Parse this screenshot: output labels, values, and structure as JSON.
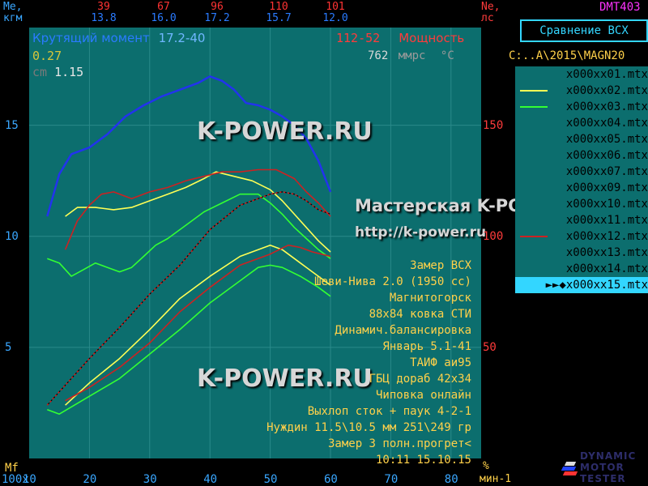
{
  "header": {
    "left_unit_line1": "Ме,",
    "left_unit_line2": "кгм",
    "right_unit_line1": "Ne,",
    "right_unit_line2": "лс",
    "device": "DMT403",
    "columns": [
      {
        "top": "39",
        "bottom": "13.8"
      },
      {
        "top": "67",
        "bottom": "16.0"
      },
      {
        "top": "96",
        "bottom": "17.2"
      },
      {
        "top": "110",
        "bottom": "15.7"
      },
      {
        "top": "101",
        "bottom": "12.0"
      }
    ]
  },
  "compare_button": "Сравнение  ВСХ",
  "path": "C:..A\\2015\\MAGN20",
  "files": [
    {
      "name": "x000xx01.mtx",
      "swatch": ""
    },
    {
      "name": "x000xx02.mtx",
      "swatch": "#ffff55"
    },
    {
      "name": "x000xx03.mtx",
      "swatch": "#33ff33"
    },
    {
      "name": "x000xx04.mtx",
      "swatch": ""
    },
    {
      "name": "x000xx05.mtx",
      "swatch": ""
    },
    {
      "name": "x000xx06.mtx",
      "swatch": ""
    },
    {
      "name": "x000xx07.mtx",
      "swatch": ""
    },
    {
      "name": "x000xx09.mtx",
      "swatch": ""
    },
    {
      "name": "x000xx10.mtx",
      "swatch": ""
    },
    {
      "name": "x000xx11.mtx",
      "swatch": ""
    },
    {
      "name": "x000xx12.mtx",
      "swatch": "#cc2222"
    },
    {
      "name": "x000xx13.mtx",
      "swatch": ""
    },
    {
      "name": "x000xx14.mtx",
      "swatch": ""
    },
    {
      "name": "►►◆x000xx15.mtx",
      "swatch": "",
      "selected": true
    }
  ],
  "legend": {
    "torque_label": "Крутящий момент",
    "torque_range": "17.2-40",
    "power_range": "112-52",
    "power_label": "Мощность",
    "param1": "0.27",
    "pressure": "762",
    "pressure_unit": "ммрс",
    "temp_unit": "°C",
    "cm_label": "cm",
    "cm_value": "1.15"
  },
  "watermarks": {
    "top": "K-POWER.RU",
    "bottom": "K-POWER.RU",
    "workshop": "Мастерская K-POWER",
    "url": "http://k-power.ru"
  },
  "notes": [
    "Замер ВСХ",
    "Шеви-Нива 2.0 (1950 cc)",
    "Магнитогорск",
    "88x84 ковка СТИ",
    "Динамич.балансировка",
    "Январь 5.1-41",
    "ТАИФ аи95",
    "ГБЦ дораб 42х34",
    "Чиповка онлайн",
    "Выхлоп сток + паук 4-2-1",
    "Нуждин 11.5\\10.5 мм 251\\249 гр",
    "Замер 3 полн.прогрет<",
    "10:11 15.10.15"
  ],
  "axes": {
    "x_multiplier": "100x",
    "x_unit_top": "%",
    "x_unit_bottom": "мин-1",
    "mf_label": "Mf",
    "x_ticks": [
      "10",
      "20",
      "30",
      "40",
      "50",
      "60",
      "70",
      "80"
    ],
    "y_left_ticks": [
      "15",
      "10",
      "5"
    ],
    "y_right_ticks": [
      "150",
      "100",
      "50"
    ]
  },
  "logo": {
    "line1": "DYNAMIC",
    "line2": "MOTOR",
    "line3": "TESTER"
  },
  "chart_data": {
    "type": "line",
    "x_unit": "100x мин-1",
    "xlim": [
      10,
      85
    ],
    "ylim_left": [
      0,
      19.4
    ],
    "ylim_right": [
      0,
      194
    ],
    "series": [
      {
        "role": "torque",
        "axis": "left",
        "color": "#2233ee",
        "x": [
          13,
          15,
          17,
          20,
          23,
          26,
          29,
          32,
          35,
          38,
          40,
          42,
          44,
          46,
          48,
          50,
          52,
          54,
          56,
          58,
          60
        ],
        "y": [
          10.9,
          12.8,
          13.7,
          14.0,
          14.6,
          15.4,
          15.9,
          16.3,
          16.6,
          16.9,
          17.2,
          17.0,
          16.6,
          16.0,
          15.9,
          15.7,
          15.4,
          15.0,
          14.4,
          13.4,
          12.0
        ]
      },
      {
        "role": "torque",
        "axis": "left",
        "color": "#ffff55",
        "x": [
          16,
          18,
          21,
          24,
          27,
          30,
          33,
          36,
          39,
          41,
          44,
          47,
          50,
          52,
          54,
          56,
          58,
          60
        ],
        "y": [
          10.9,
          11.3,
          11.3,
          11.2,
          11.3,
          11.6,
          11.9,
          12.2,
          12.6,
          12.9,
          12.7,
          12.5,
          12.1,
          11.6,
          11.0,
          10.4,
          9.8,
          9.3
        ]
      },
      {
        "role": "torque",
        "axis": "left",
        "color": "#33ff33",
        "x": [
          13,
          15,
          17,
          19,
          21,
          23,
          25,
          27,
          29,
          31,
          33,
          36,
          39,
          42,
          45,
          48,
          50,
          52,
          54,
          56,
          58,
          60
        ],
        "y": [
          9.0,
          8.8,
          8.2,
          8.5,
          8.8,
          8.6,
          8.4,
          8.6,
          9.1,
          9.6,
          9.9,
          10.5,
          11.1,
          11.5,
          11.9,
          11.9,
          11.5,
          11.0,
          10.4,
          9.9,
          9.4,
          9.0
        ]
      },
      {
        "role": "torque",
        "axis": "left",
        "color": "#cc2222",
        "x": [
          16,
          18,
          20,
          22,
          24,
          27,
          30,
          33,
          36,
          39,
          42,
          45,
          48,
          51,
          54,
          56,
          58,
          60
        ],
        "y": [
          9.4,
          10.7,
          11.4,
          11.9,
          12.0,
          11.7,
          12.0,
          12.2,
          12.5,
          12.7,
          12.9,
          12.9,
          13.0,
          13.0,
          12.6,
          12.0,
          11.5,
          10.9
        ]
      },
      {
        "role": "power",
        "axis": "right",
        "color": "#ffff55",
        "x": [
          16,
          20,
          25,
          30,
          35,
          40,
          45,
          50,
          52,
          55,
          58,
          60
        ],
        "y": [
          24,
          34,
          45,
          58,
          72,
          82,
          91,
          96,
          94,
          88,
          82,
          78
        ]
      },
      {
        "role": "power",
        "axis": "right",
        "color": "#33ff33",
        "x": [
          13,
          15,
          20,
          25,
          30,
          35,
          40,
          45,
          48,
          50,
          52,
          55,
          58,
          60
        ],
        "y": [
          22,
          20,
          28,
          36,
          47,
          58,
          70,
          80,
          86,
          87,
          86,
          82,
          77,
          73
        ]
      },
      {
        "role": "power",
        "axis": "right",
        "color": "#cc2222",
        "x": [
          16,
          20,
          25,
          30,
          35,
          40,
          45,
          50,
          53,
          55,
          57,
          60
        ],
        "y": [
          26,
          32,
          41,
          52,
          66,
          77,
          87,
          92,
          96,
          95,
          93,
          91
        ]
      },
      {
        "role": "power",
        "axis": "right",
        "color": "#dd1111",
        "dashed": true,
        "x": [
          13,
          15,
          20,
          25,
          30,
          35,
          40,
          45,
          50,
          52,
          54,
          56,
          58,
          60
        ],
        "y": [
          24,
          30,
          45,
          59,
          74,
          87,
          103,
          114,
          119,
          120,
          119,
          116,
          112,
          110
        ]
      }
    ]
  }
}
